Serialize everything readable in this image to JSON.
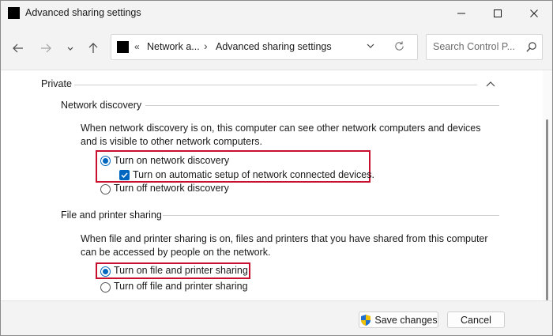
{
  "window": {
    "title": "Advanced sharing settings"
  },
  "nav": {
    "breadcrumb_chevron": "«",
    "breadcrumb_parent": "Network a...",
    "breadcrumb_separator": "›",
    "breadcrumb_current": "Advanced sharing settings",
    "search_placeholder": "Search Control P..."
  },
  "profile": {
    "name": "Private",
    "sections": {
      "network_discovery": {
        "heading": "Network discovery",
        "description": "When network discovery is on, this computer can see other network computers and devices and is visible to other network computers.",
        "option_on": "Turn on network discovery",
        "option_auto_setup": "Turn on automatic setup of network connected devices.",
        "option_off": "Turn off network discovery"
      },
      "file_printer_sharing": {
        "heading": "File and printer sharing",
        "description": "When file and printer sharing is on, files and printers that you have shared from this computer can be accessed by people on the network.",
        "option_on": "Turn on file and printer sharing",
        "option_off": "Turn off file and printer sharing"
      }
    }
  },
  "state": {
    "network_discovery": "on",
    "auto_setup_checked": true,
    "file_printer_sharing": "on"
  },
  "footer": {
    "save_label": "Save changes",
    "cancel_label": "Cancel"
  },
  "icons": {
    "app": "app-icon",
    "back": "arrow-left-icon",
    "forward": "arrow-right-icon",
    "recent": "chevron-down-icon",
    "up": "arrow-up-icon",
    "refresh": "refresh-icon",
    "search": "search-icon",
    "shield": "uac-shield-icon"
  },
  "colors": {
    "accent": "#0067c0",
    "highlight_box": "#c8102e"
  }
}
